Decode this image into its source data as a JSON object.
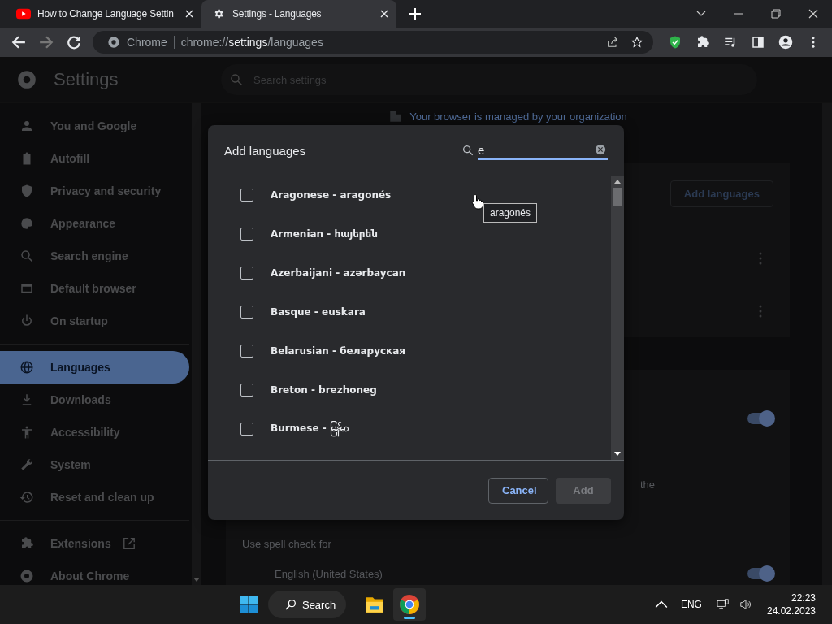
{
  "tabs": [
    {
      "title": "How to Change Language Settin",
      "selected": false
    },
    {
      "title": "Settings - Languages",
      "selected": true
    }
  ],
  "address_bar": {
    "site_label": "Chrome",
    "url_scheme": "chrome://",
    "url_host": "settings",
    "url_path": "/languages"
  },
  "settings_header": {
    "title": "Settings",
    "search_placeholder": "Search settings"
  },
  "sidebar": {
    "sections": [
      [
        {
          "label": "You and Google",
          "selected": false
        },
        {
          "label": "Autofill",
          "selected": false
        },
        {
          "label": "Privacy and security",
          "selected": false
        },
        {
          "label": "Appearance",
          "selected": false
        },
        {
          "label": "Search engine",
          "selected": false
        },
        {
          "label": "Default browser",
          "selected": false
        },
        {
          "label": "On startup",
          "selected": false
        }
      ],
      [
        {
          "label": "Languages",
          "selected": true
        },
        {
          "label": "Downloads",
          "selected": false
        },
        {
          "label": "Accessibility",
          "selected": false
        },
        {
          "label": "System",
          "selected": false
        },
        {
          "label": "Reset and clean up",
          "selected": false
        }
      ],
      [
        {
          "label": "Extensions",
          "selected": false,
          "external": true
        },
        {
          "label": "About Chrome",
          "selected": false,
          "external": false
        }
      ]
    ]
  },
  "managed_notice": "Your browser is managed by your organization",
  "background_card": {
    "add_button": "Add languages",
    "toggle_on": true,
    "partial_text": "the",
    "spell_check_label": "Use spell check for",
    "spell_language": "English (United States)",
    "spell_toggle_on": true
  },
  "dialog": {
    "title": "Add languages",
    "search_value": "e",
    "languages": [
      {
        "label": "Aragonese - aragonés",
        "checked": false
      },
      {
        "label": "Armenian - հայերեն",
        "checked": false
      },
      {
        "label": "Azerbaijani - azərbaycan",
        "checked": false
      },
      {
        "label": "Basque - euskara",
        "checked": false
      },
      {
        "label": "Belarusian - беларуская",
        "checked": false
      },
      {
        "label": "Breton - brezhoneg",
        "checked": false
      },
      {
        "label": "Burmese - မြန်မာ",
        "checked": false
      }
    ],
    "tooltip": "aragonés",
    "buttons": [
      {
        "label": "Cancel",
        "kind": "secondary",
        "disabled": false
      },
      {
        "label": "Add",
        "kind": "primary",
        "disabled": true
      }
    ]
  },
  "taskbar": {
    "search_label": "Search",
    "language": "ENG",
    "time": "22:23",
    "date": "24.02.2023"
  }
}
